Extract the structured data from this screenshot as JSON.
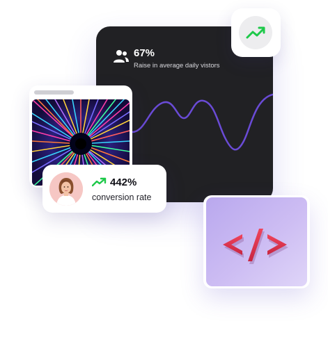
{
  "stats": {
    "visitors_value": "67%",
    "visitors_caption": "Raise in average daily vistors"
  },
  "conversion": {
    "value": "442%",
    "label": "conversion rate"
  },
  "icons": {
    "users": "users-icon",
    "trend_badge": "trend-up-icon",
    "conversion_trend": "trend-up-icon",
    "code": "code-tag-icon"
  },
  "colors": {
    "card_dark": "#212124",
    "wave_line": "#6a4bd6",
    "trend_green": "#1ec94a",
    "code_red": "#e5384f",
    "code_bg": "#c4b3ef"
  }
}
